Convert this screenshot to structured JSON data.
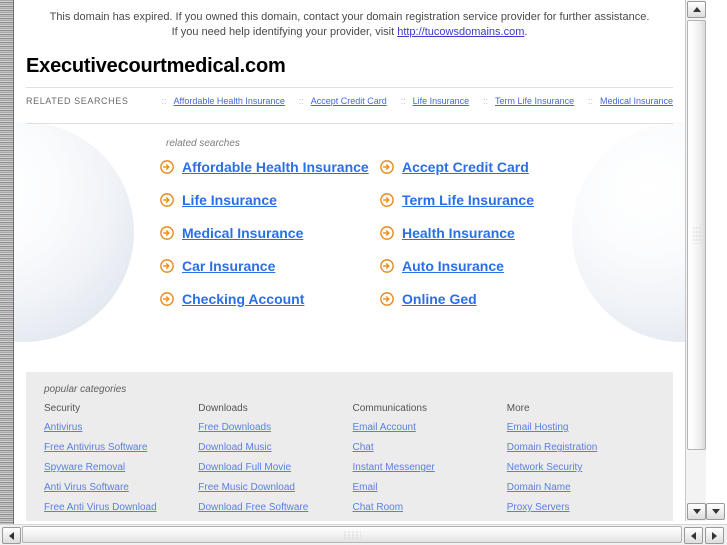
{
  "notice": {
    "text_before": "This domain has expired. If you owned this domain, contact your domain registration service provider for further assistance. If you need help identifying your provider, visit ",
    "link_text": "http://tucowsdomains.com",
    "text_after": "."
  },
  "domain": {
    "title": "Executivecourtmedical.com"
  },
  "related_bar": {
    "label": "RELATED SEARCHES",
    "separator": "::",
    "items": [
      "Affordable Health Insurance",
      "Accept Credit Card",
      "Life Insurance",
      "Term Life Insurance",
      "Medical Insurance"
    ]
  },
  "searches": {
    "caption": "related searches",
    "arrow_icon": "circle-arrow-right-icon",
    "items": [
      "Affordable Health Insurance",
      "Accept Credit Card",
      "Life Insurance",
      "Term Life Insurance",
      "Medical Insurance",
      "Health Insurance",
      "Car Insurance",
      "Auto Insurance",
      "Checking Account",
      "Online Ged"
    ]
  },
  "categories": {
    "caption": "popular categories",
    "columns": [
      {
        "heading": "Security",
        "links": [
          "Antivirus",
          "Free Antivirus Software",
          "Spyware Removal",
          "Anti Virus Software",
          "Free Anti Virus Download"
        ]
      },
      {
        "heading": "Downloads",
        "links": [
          "Free Downloads",
          "Download Music",
          "Download Full Movie",
          "Free Music Download",
          "Download Free Software"
        ]
      },
      {
        "heading": "Communications",
        "links": [
          "Email Account",
          "Chat",
          "Instant Messenger",
          "Email",
          "Chat Room"
        ]
      },
      {
        "heading": "More",
        "links": [
          "Email Hosting",
          "Domain Registration",
          "Network Security",
          "Domain Name",
          "Proxy Servers"
        ]
      }
    ]
  },
  "colors": {
    "link_blue": "#2b6fe8",
    "small_link_blue": "#5b7fe0",
    "arrow_orange": "#f0921e",
    "categories_bg": "#ececec"
  }
}
